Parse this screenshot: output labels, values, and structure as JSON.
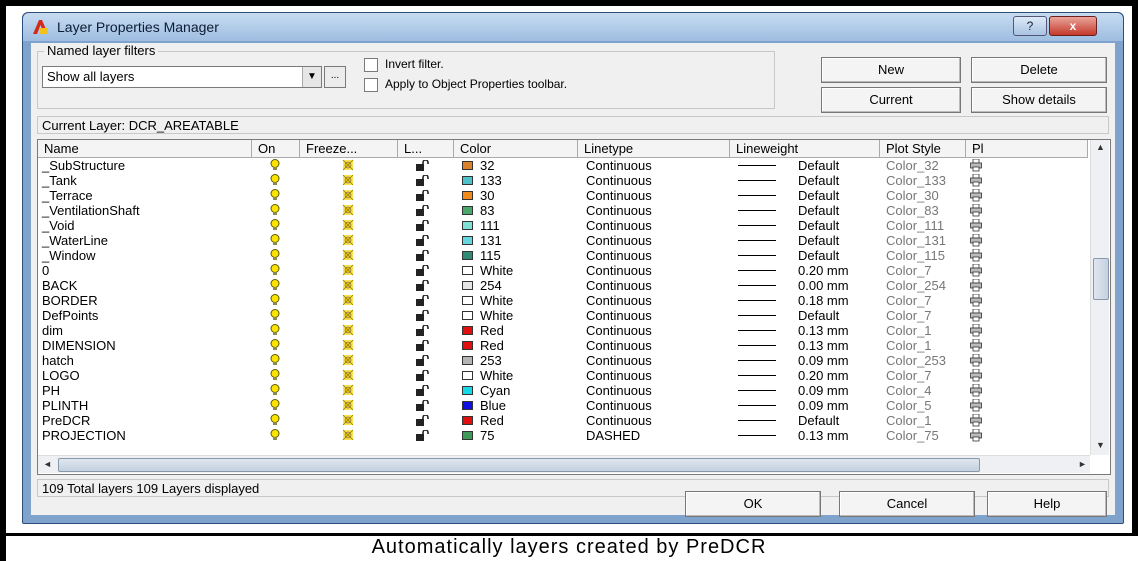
{
  "window": {
    "title": "Layer Properties Manager",
    "help_label": "?",
    "close_label": "x"
  },
  "filters": {
    "group_label": "Named layer filters",
    "selected": "Show all layers",
    "dots_label": "...",
    "invert_label": "Invert filter.",
    "invert_checked": false,
    "apply_label": "Apply to Object Properties toolbar.",
    "apply_checked": false
  },
  "buttons": {
    "new": "New",
    "delete": "Delete",
    "current": "Current",
    "show_details": "Show details",
    "ok": "OK",
    "cancel": "Cancel",
    "help": "Help"
  },
  "current_layer": "Current Layer:  DCR_AREATABLE",
  "columns": [
    "Name",
    "On",
    "Freeze...",
    "L...",
    "Color",
    "Linetype",
    "Lineweight",
    "Plot Style",
    "Pl"
  ],
  "layers": [
    {
      "name": "_SubStructure",
      "color_name": "32",
      "color_hex": "#d9822b",
      "linetype": "Continuous",
      "lineweight": "Default",
      "plot_style": "Color_32"
    },
    {
      "name": "_Tank",
      "color_name": "133",
      "color_hex": "#4fc1c9",
      "linetype": "Continuous",
      "lineweight": "Default",
      "plot_style": "Color_133"
    },
    {
      "name": "_Terrace",
      "color_name": "30",
      "color_hex": "#f08a1d",
      "linetype": "Continuous",
      "lineweight": "Default",
      "plot_style": "Color_30"
    },
    {
      "name": "_VentilationShaft",
      "color_name": "83",
      "color_hex": "#4ba86a",
      "linetype": "Continuous",
      "lineweight": "Default",
      "plot_style": "Color_83"
    },
    {
      "name": "_Void",
      "color_name": "111",
      "color_hex": "#7fe0d3",
      "linetype": "Continuous",
      "lineweight": "Default",
      "plot_style": "Color_111"
    },
    {
      "name": "_WaterLine",
      "color_name": "131",
      "color_hex": "#66d6de",
      "linetype": "Continuous",
      "lineweight": "Default",
      "plot_style": "Color_131"
    },
    {
      "name": "_Window",
      "color_name": "115",
      "color_hex": "#2f8b72",
      "linetype": "Continuous",
      "lineweight": "Default",
      "plot_style": "Color_115"
    },
    {
      "name": "0",
      "color_name": "White",
      "color_hex": "#ffffff",
      "linetype": "Continuous",
      "lineweight": "0.20 mm",
      "plot_style": "Color_7"
    },
    {
      "name": "BACK",
      "color_name": "254",
      "color_hex": "#e4e4e4",
      "linetype": "Continuous",
      "lineweight": "0.00 mm",
      "plot_style": "Color_254"
    },
    {
      "name": "BORDER",
      "color_name": "White",
      "color_hex": "#ffffff",
      "linetype": "Continuous",
      "lineweight": "0.18 mm",
      "plot_style": "Color_7"
    },
    {
      "name": "DefPoints",
      "color_name": "White",
      "color_hex": "#ffffff",
      "linetype": "Continuous",
      "lineweight": "Default",
      "plot_style": "Color_7"
    },
    {
      "name": "dim",
      "color_name": "Red",
      "color_hex": "#e01010",
      "linetype": "Continuous",
      "lineweight": "0.13 mm",
      "plot_style": "Color_1"
    },
    {
      "name": "DIMENSION",
      "color_name": "Red",
      "color_hex": "#e01010",
      "linetype": "Continuous",
      "lineweight": "0.13 mm",
      "plot_style": "Color_1"
    },
    {
      "name": "hatch",
      "color_name": "253",
      "color_hex": "#b4b4b4",
      "linetype": "Continuous",
      "lineweight": "0.09 mm",
      "plot_style": "Color_253"
    },
    {
      "name": "LOGO",
      "color_name": "White",
      "color_hex": "#ffffff",
      "linetype": "Continuous",
      "lineweight": "0.20 mm",
      "plot_style": "Color_7"
    },
    {
      "name": "PH",
      "color_name": "Cyan",
      "color_hex": "#16d8e6",
      "linetype": "Continuous",
      "lineweight": "0.09 mm",
      "plot_style": "Color_4"
    },
    {
      "name": "PLINTH",
      "color_name": "Blue",
      "color_hex": "#1010e0",
      "linetype": "Continuous",
      "lineweight": "0.09 mm",
      "plot_style": "Color_5"
    },
    {
      "name": "PreDCR",
      "color_name": "Red",
      "color_hex": "#e01010",
      "linetype": "Continuous",
      "lineweight": "Default",
      "plot_style": "Color_1"
    },
    {
      "name": "PROJECTION",
      "color_name": "75",
      "color_hex": "#3f9a5a",
      "linetype": "DASHED",
      "lineweight": "0.13 mm",
      "plot_style": "Color_75"
    }
  ],
  "status": "109 Total layers 109 Layers displayed",
  "caption": "Automatically layers created by PreDCR",
  "icons": {
    "on": "lightbulb-icon",
    "freeze": "sun-icon",
    "lock": "unlock-icon",
    "plot": "printer-icon"
  }
}
